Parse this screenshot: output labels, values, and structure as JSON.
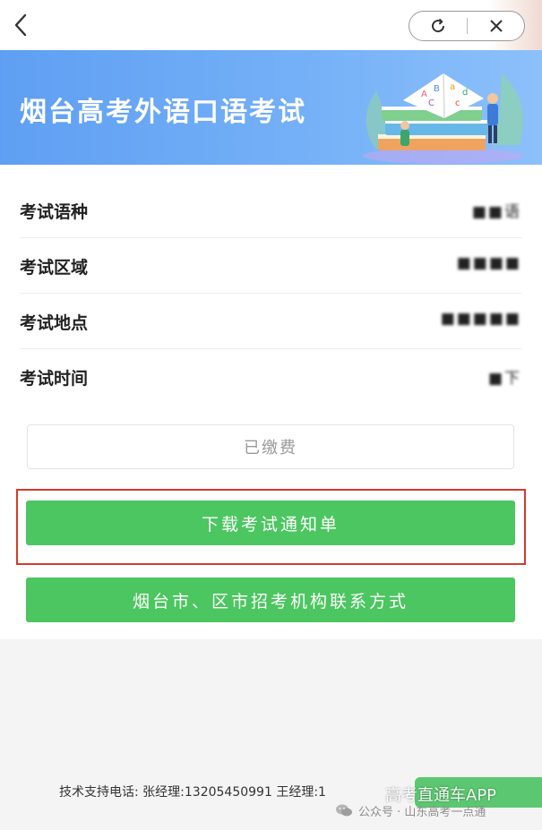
{
  "header": {
    "banner_title": "烟台高考外语口语考试"
  },
  "info_rows": [
    {
      "label": "考试语种",
      "value": "■■语"
    },
    {
      "label": "考试区域",
      "value": "■■■■"
    },
    {
      "label": "考试地点",
      "value": "■■■■■"
    },
    {
      "label": "考试时间",
      "value": "■下"
    }
  ],
  "status": {
    "paid_label": "已缴费"
  },
  "buttons": {
    "download_notice": "下载考试通知单",
    "contact": "烟台市、区市招考机构联系方式"
  },
  "footer": {
    "support_text": "技术支持电话: 张经理:13205450991 王经理:1",
    "watermark_title": "高考直通车APP",
    "wechat_account": "公众号 · 山东高考一点通"
  },
  "colors": {
    "banner": "#6aa8f5",
    "button_green": "#4cc660",
    "highlight_red": "#d23b2f"
  },
  "icons": {
    "back": "chevron-left-icon",
    "refresh": "refresh-icon",
    "close": "close-icon",
    "wechat": "wechat-icon"
  }
}
